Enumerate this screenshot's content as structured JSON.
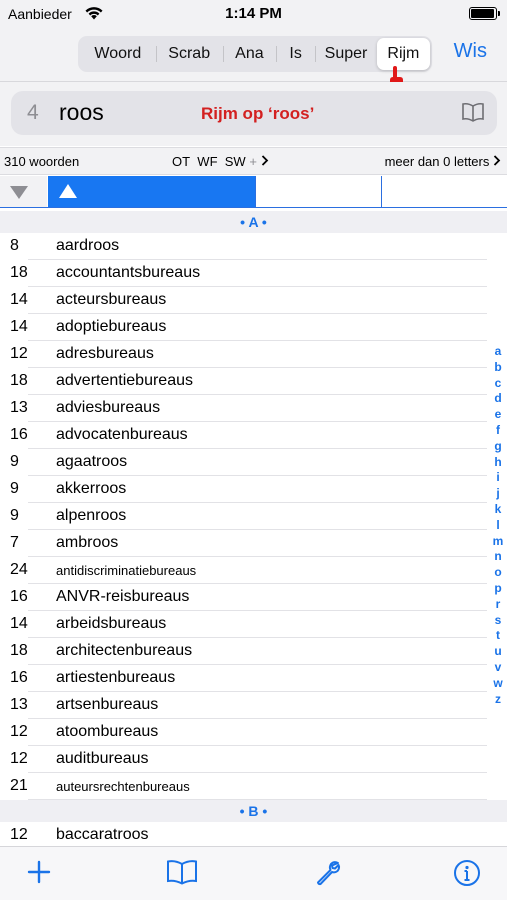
{
  "status": {
    "carrier": "Aanbieder",
    "time": "1:14 PM",
    "battery_level": 0.95,
    "icons": [
      "wifi-icon",
      "battery-icon"
    ]
  },
  "toolbar": {
    "segments": [
      {
        "label": "Woord",
        "selected": false
      },
      {
        "label": "Scrab",
        "selected": false
      },
      {
        "label": "Ana",
        "selected": false
      },
      {
        "label": "Is",
        "selected": false
      },
      {
        "label": "Super",
        "selected": false
      },
      {
        "label": "Rijm",
        "selected": true
      }
    ],
    "clear_label": "Wis"
  },
  "search": {
    "length": "4",
    "term": "roos",
    "mode_label": "Rijm op ‘roos’"
  },
  "info": {
    "count": "310 woorden",
    "filters": [
      "OT",
      "WF",
      "SW"
    ],
    "filter_more": "+",
    "min_letters": "meer dan 0 letters"
  },
  "list": {
    "section_a": "• A •",
    "section_b": "• B •",
    "items_a": [
      {
        "n": "8",
        "w": "aardroos"
      },
      {
        "n": "18",
        "w": "accountantsbureaus"
      },
      {
        "n": "14",
        "w": "acteursbureaus"
      },
      {
        "n": "14",
        "w": "adoptiebureaus"
      },
      {
        "n": "12",
        "w": "adresbureaus"
      },
      {
        "n": "18",
        "w": "advertentiebureaus"
      },
      {
        "n": "13",
        "w": "adviesbureaus"
      },
      {
        "n": "16",
        "w": "advocatenbureaus"
      },
      {
        "n": "9",
        "w": "agaatroos"
      },
      {
        "n": "9",
        "w": "akkerroos"
      },
      {
        "n": "9",
        "w": "alpenroos"
      },
      {
        "n": "7",
        "w": "ambroos"
      },
      {
        "n": "24",
        "w": "antidiscriminatiebureaus"
      },
      {
        "n": "16",
        "w": "ANVR-reisbureaus"
      },
      {
        "n": "14",
        "w": "arbeidsbureaus"
      },
      {
        "n": "18",
        "w": "architectenbureaus"
      },
      {
        "n": "16",
        "w": "artiestenbureaus"
      },
      {
        "n": "13",
        "w": "artsenbureaus"
      },
      {
        "n": "12",
        "w": "atoombureaus"
      },
      {
        "n": "12",
        "w": "auditbureaus"
      },
      {
        "n": "21",
        "w": "auteursrechtenbureaus"
      }
    ],
    "items_b": [
      {
        "n": "12",
        "w": "baccaratroos"
      }
    ]
  },
  "index_letters": [
    "a",
    "b",
    "c",
    "d",
    "e",
    "f",
    "g",
    "h",
    "i",
    "j",
    "k",
    "l",
    "m",
    "n",
    "o",
    "p",
    "r",
    "s",
    "t",
    "u",
    "v",
    "w",
    "z"
  ],
  "colors": {
    "accent": "#1a73e8",
    "mode_red": "#d32020",
    "sort_blue": "#1877f2"
  }
}
